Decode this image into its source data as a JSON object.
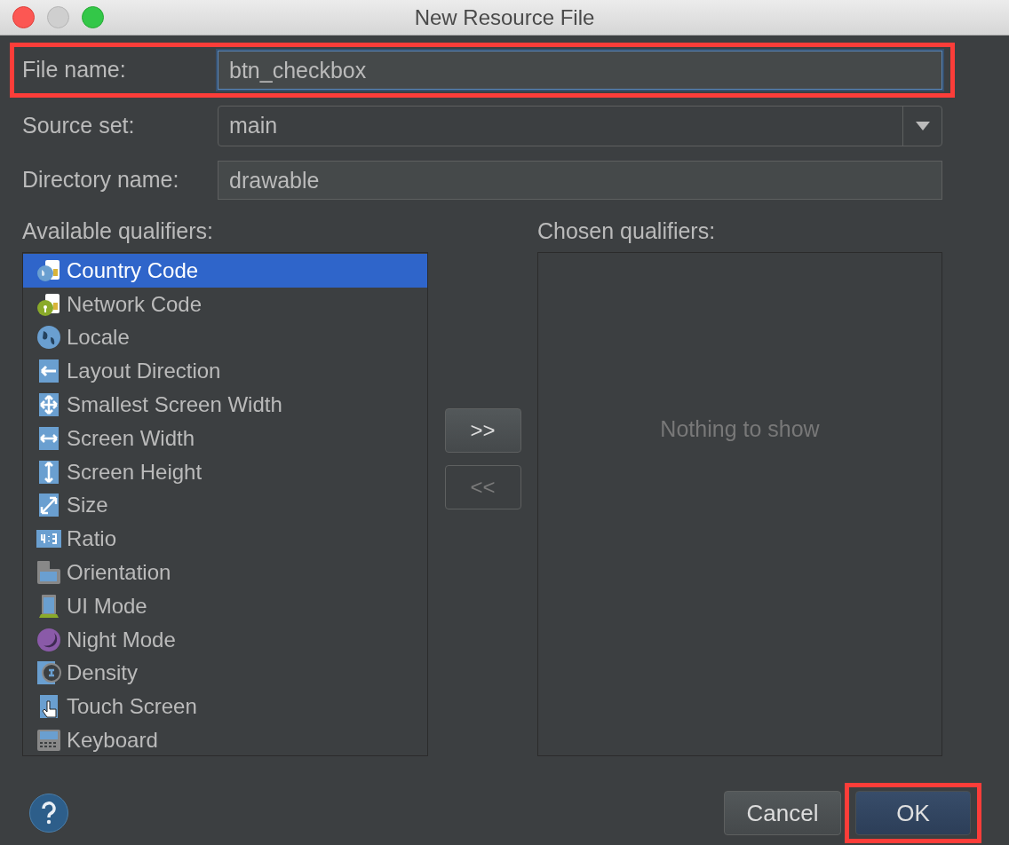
{
  "window": {
    "title": "New Resource File"
  },
  "fields": [
    {
      "kind": "text",
      "label": "File name:",
      "value": "btn_checkbox",
      "focused": true,
      "highlighted": true
    },
    {
      "kind": "dropdown",
      "label": "Source set:",
      "value": "main",
      "focused": false,
      "highlighted": false
    },
    {
      "kind": "text",
      "label": "Directory name:",
      "value": "drawable",
      "focused": false,
      "highlighted": false
    }
  ],
  "available": {
    "label": "Available qualifiers:",
    "items": [
      {
        "label": "Country Code",
        "selected": true
      },
      {
        "label": "Network Code",
        "selected": false
      },
      {
        "label": "Locale",
        "selected": false
      },
      {
        "label": "Layout Direction",
        "selected": false
      },
      {
        "label": "Smallest Screen Width",
        "selected": false
      },
      {
        "label": "Screen Width",
        "selected": false
      },
      {
        "label": "Screen Height",
        "selected": false
      },
      {
        "label": "Size",
        "selected": false
      },
      {
        "label": "Ratio",
        "selected": false
      },
      {
        "label": "Orientation",
        "selected": false
      },
      {
        "label": "UI Mode",
        "selected": false
      },
      {
        "label": "Night Mode",
        "selected": false
      },
      {
        "label": "Density",
        "selected": false
      },
      {
        "label": "Touch Screen",
        "selected": false
      },
      {
        "label": "Keyboard",
        "selected": false
      }
    ]
  },
  "transfer_buttons": [
    {
      "label": ">>",
      "disabled": false
    },
    {
      "label": "<<",
      "disabled": true
    }
  ],
  "chosen": {
    "label": "Chosen qualifiers:",
    "empty_text": "Nothing to show"
  },
  "buttons": [
    {
      "label": "Cancel",
      "default": false,
      "highlighted": false
    },
    {
      "label": "OK",
      "default": true,
      "highlighted": true
    }
  ]
}
